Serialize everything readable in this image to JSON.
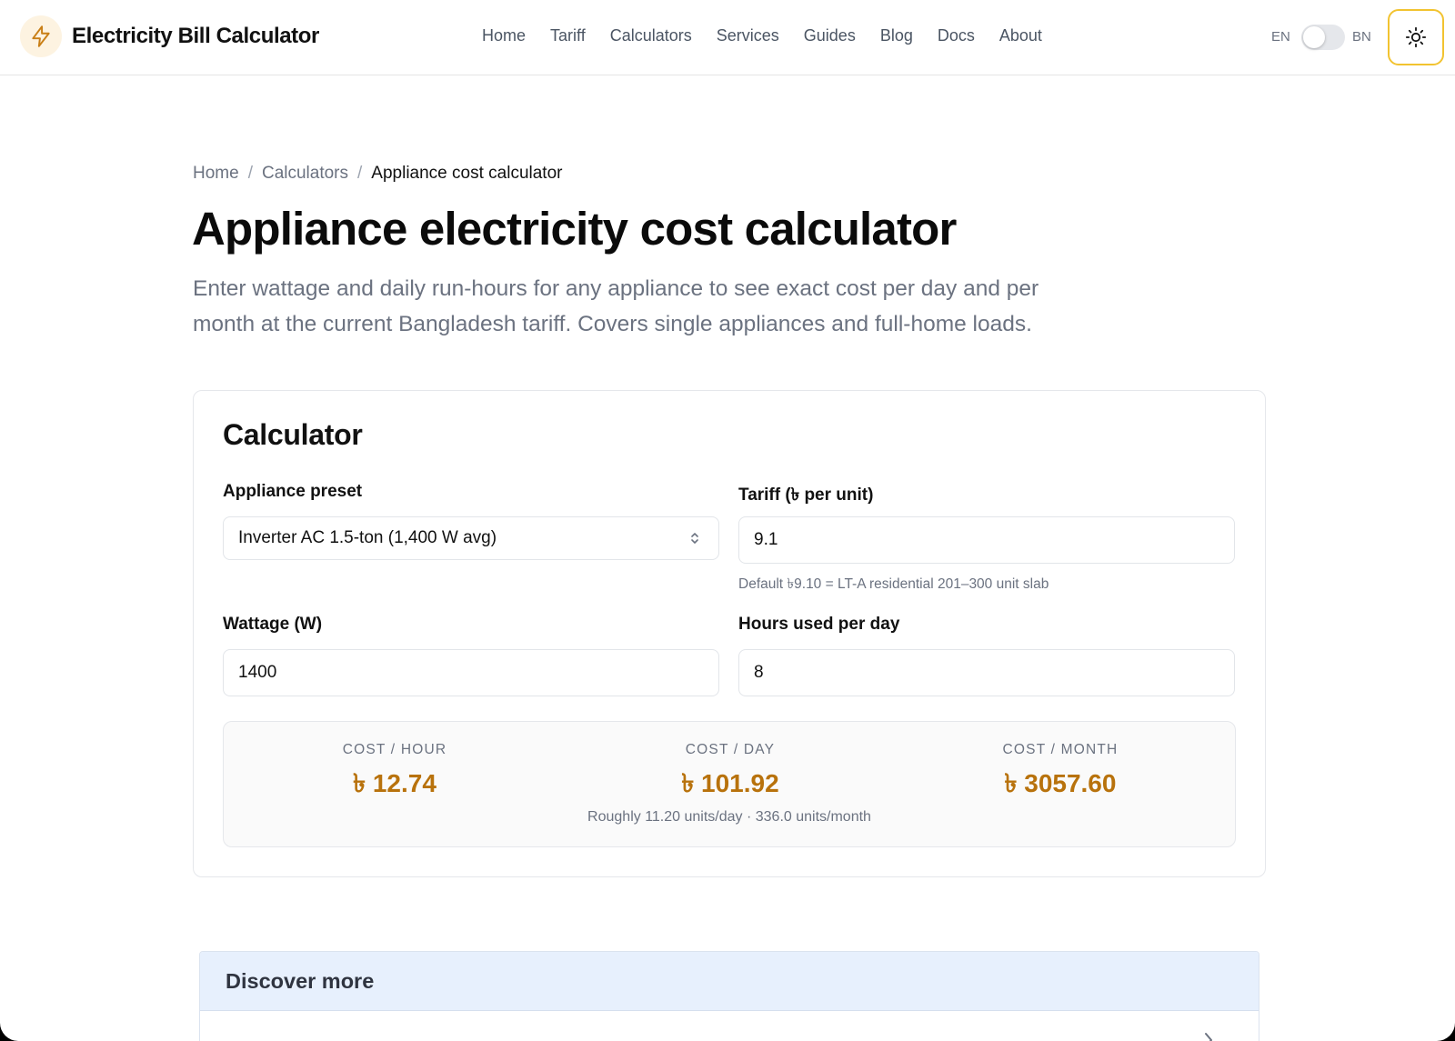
{
  "header": {
    "brand": "Electricity Bill Calculator",
    "logo_icon": "lightning-bolt-icon",
    "nav": [
      "Home",
      "Tariff",
      "Calculators",
      "Services",
      "Guides",
      "Blog",
      "Docs",
      "About"
    ],
    "lang_en": "EN",
    "lang_bn": "BN",
    "theme_icon": "sun-icon"
  },
  "breadcrumb": {
    "home": "Home",
    "sep": "/",
    "calculators": "Calculators",
    "current": "Appliance cost calculator"
  },
  "page": {
    "title": "Appliance electricity cost calculator",
    "intro": "Enter wattage and daily run-hours for any appliance to see exact cost per day and per month at the current Bangladesh tariff. Covers single appliances and full-home loads."
  },
  "calculator": {
    "title": "Calculator",
    "preset_label": "Appliance preset",
    "preset_value": "Inverter AC 1.5-ton (1,400 W avg)",
    "tariff_label": "Tariff (৳ per unit)",
    "tariff_value": "9.1",
    "tariff_hint": "Default ৳9.10 = LT-A residential 201–300 unit slab",
    "wattage_label": "Wattage (W)",
    "wattage_value": "1400",
    "hours_label": "Hours used per day",
    "hours_value": "8"
  },
  "results": {
    "hour_label": "COST / HOUR",
    "hour_value": "৳ 12.74",
    "day_label": "COST / DAY",
    "day_value": "৳ 101.92",
    "month_label": "COST / MONTH",
    "month_value": "৳ 3057.60",
    "note": "Roughly 11.20 units/day · 336.0 units/month"
  },
  "discover": {
    "title": "Discover more"
  },
  "colors": {
    "accent": "#b8720c",
    "focus_ring": "#f2c330",
    "discover_bg": "#e7f0fd"
  }
}
